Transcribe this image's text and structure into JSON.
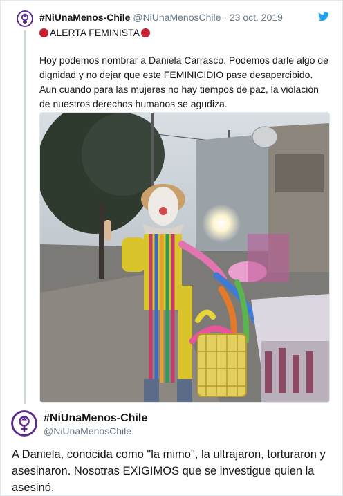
{
  "quoted_tweet": {
    "author_name": "#NiUnaMenos-Chile",
    "author_handle": "@NiUnaMenosChile",
    "separator": "·",
    "date": "23 oct. 2019",
    "alert_text": "ALERTA FEMINISTA",
    "body": "Hoy podemos nombrar a Daniela Carrasco. Podemos darle algo de dignidad y no dejar que este FEMINICIDIO pase desapercibido. Aun cuando para las mujeres no hay tiempos de paz, la violación de nuestros derechos humanos se agudiza.",
    "media_icon": "photo-of-clown-with-balloons"
  },
  "main_tweet": {
    "author_name": "#NiUnaMenos-Chile",
    "author_handle": "@NiUnaMenosChile",
    "body": "A Daniela, conocida como \"la mimo\", la ultrajaron, torturaron y asesinaron. Nosotras EXIGIMOS que se investigue quien la asesinó."
  },
  "colors": {
    "brand_purple": "#5d2a8c",
    "twitter_blue": "#1da1f2",
    "alert_red": "#c62034",
    "muted_text": "#657786",
    "border": "#e1e8ed"
  }
}
